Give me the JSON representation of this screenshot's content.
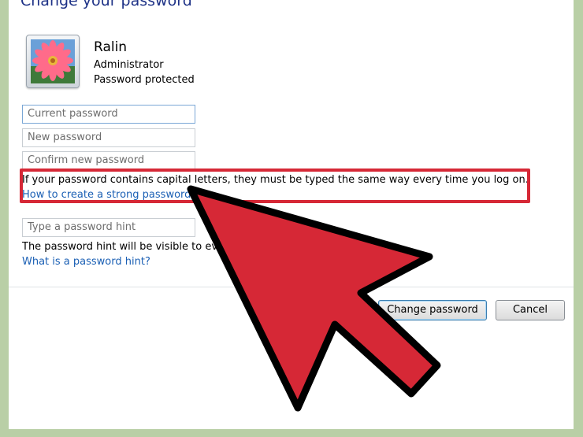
{
  "window": {
    "title": "Change your password"
  },
  "user": {
    "name": "Ralin",
    "role": "Administrator",
    "status": "Password protected"
  },
  "fields": {
    "current_password_placeholder": "Current password",
    "new_password_placeholder": "New password",
    "confirm_password_placeholder": "Confirm new password",
    "hint_placeholder": "Type a password hint"
  },
  "notes": {
    "capitals_note": "If your password contains capital letters, they must be typed the same way every time you log on.",
    "strong_password_link": "How to create a strong password",
    "hint_visibility_note": "The password hint will be visible to ever",
    "hint_link": "What is a password hint?"
  },
  "buttons": {
    "change_password": "Change password",
    "cancel": "Cancel"
  },
  "colors": {
    "highlight": "#d62836",
    "arrow_fill": "#d62836",
    "link": "#1a5fb4",
    "title": "#1e3287"
  },
  "icons": {
    "avatar": "flower-avatar-icon",
    "overlay": "pointer-arrow-icon"
  }
}
